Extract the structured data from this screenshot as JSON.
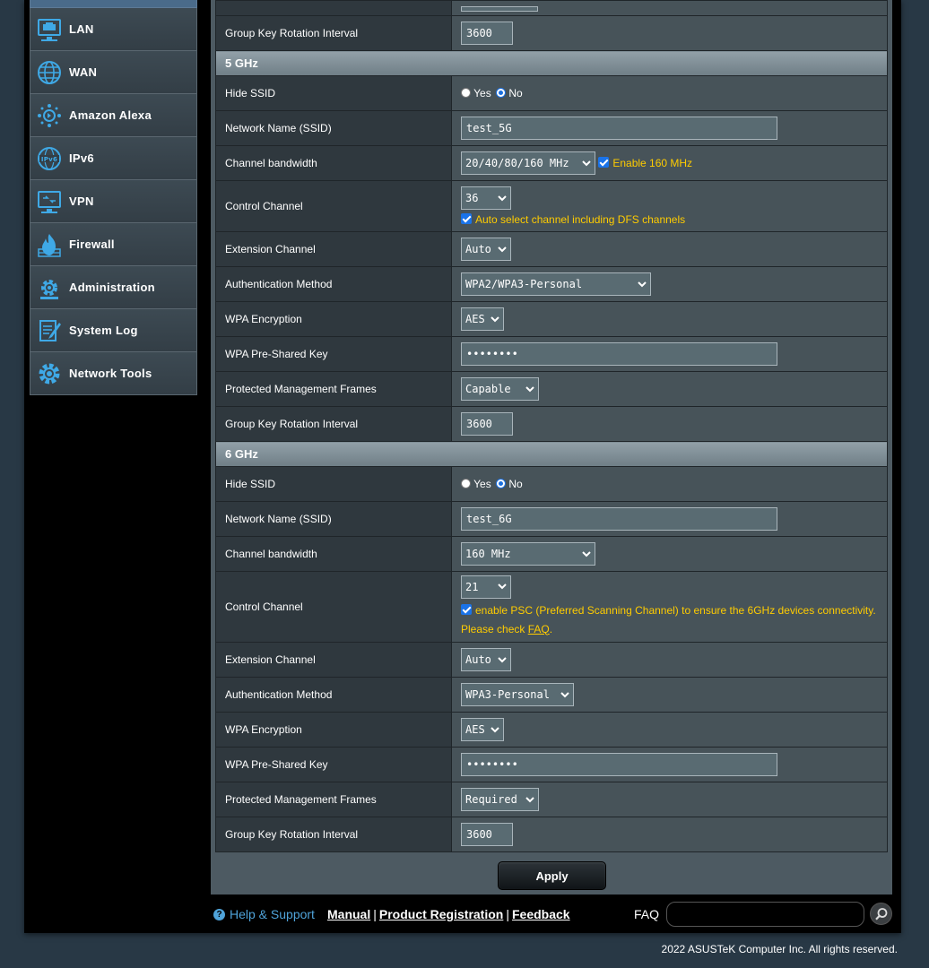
{
  "sidebar": {
    "items": [
      {
        "label": "LAN",
        "icon": "lan-icon"
      },
      {
        "label": "WAN",
        "icon": "globe-icon"
      },
      {
        "label": "Amazon Alexa",
        "icon": "alexa-icon"
      },
      {
        "label": "IPv6",
        "icon": "ipv6-icon"
      },
      {
        "label": "VPN",
        "icon": "vpn-icon"
      },
      {
        "label": "Firewall",
        "icon": "firewall-icon"
      },
      {
        "label": "Administration",
        "icon": "gear-icon"
      },
      {
        "label": "System Log",
        "icon": "system-log-icon"
      },
      {
        "label": "Network Tools",
        "icon": "network-tools-icon"
      }
    ]
  },
  "top": {
    "group_key_label": "Group Key Rotation Interval",
    "group_key_value": "3600"
  },
  "band5": {
    "title": "5 GHz",
    "hide_ssid_label": "Hide SSID",
    "yes": "Yes",
    "no": "No",
    "ssid_label": "Network Name (SSID)",
    "ssid_value": "test_5G",
    "bandwidth_label": "Channel bandwidth",
    "bandwidth_value": "20/40/80/160 MHz",
    "enable160": "Enable 160 MHz",
    "control_label": "Control Channel",
    "control_value": "36",
    "auto_dfs": "Auto select channel including DFS channels",
    "ext_label": "Extension Channel",
    "ext_value": "Auto",
    "auth_label": "Authentication Method",
    "auth_value": "WPA2/WPA3-Personal",
    "enc_label": "WPA Encryption",
    "enc_value": "AES",
    "psk_label": "WPA Pre-Shared Key",
    "psk_value": "••••••••",
    "pmf_label": "Protected Management Frames",
    "pmf_value": "Capable",
    "gk_label": "Group Key Rotation Interval",
    "gk_value": "3600"
  },
  "band6": {
    "title": "6 GHz",
    "hide_ssid_label": "Hide SSID",
    "yes": "Yes",
    "no": "No",
    "ssid_label": "Network Name (SSID)",
    "ssid_value": "test_6G",
    "bandwidth_label": "Channel bandwidth",
    "bandwidth_value": "160 MHz",
    "control_label": "Control Channel",
    "control_value": "21",
    "psc_text": "enable PSC (Preferred Scanning Channel) to ensure the 6GHz devices connectivity.",
    "please_check": "Please check",
    "faq_link": "FAQ",
    "period": ".",
    "ext_label": "Extension Channel",
    "ext_value": "Auto",
    "auth_label": "Authentication Method",
    "auth_value": "WPA3-Personal",
    "enc_label": "WPA Encryption",
    "enc_value": "AES",
    "psk_label": "WPA Pre-Shared Key",
    "psk_value": "••••••••",
    "pmf_label": "Protected Management Frames",
    "pmf_value": "Required",
    "gk_label": "Group Key Rotation Interval",
    "gk_value": "3600"
  },
  "apply_label": "Apply",
  "footer": {
    "help": "Help & Support",
    "manual": "Manual",
    "registration": "Product Registration",
    "feedback": "Feedback",
    "sep": "|",
    "faq": "FAQ",
    "copyright": "2022 ASUSTeK Computer Inc. All rights reserved."
  },
  "colors": {
    "accent_yellow": "#ffcc00",
    "help_blue": "#4fa3d9",
    "checkbox_blue": "#1a73e8"
  }
}
